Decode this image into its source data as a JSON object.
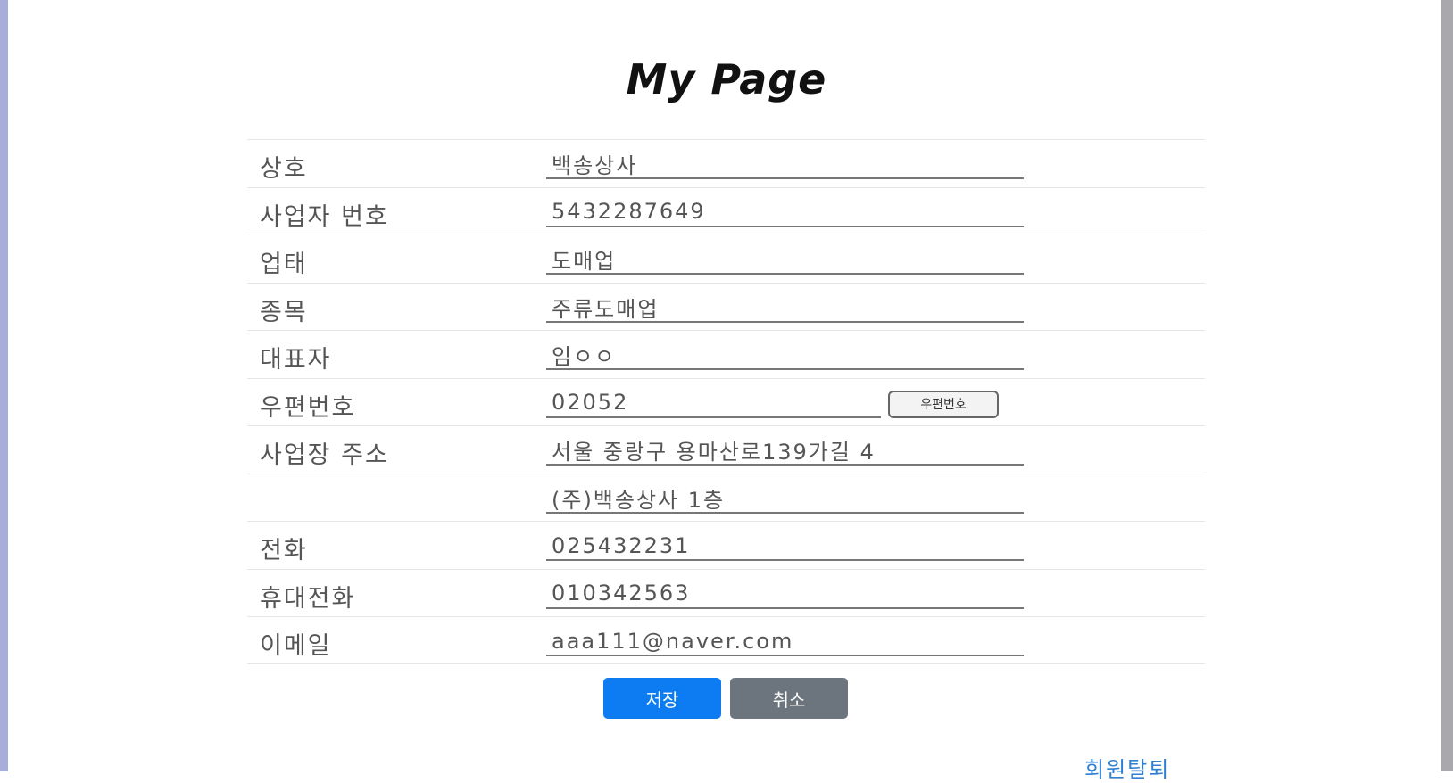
{
  "page": {
    "title": "My Page"
  },
  "form": {
    "rows": [
      {
        "label": "상호",
        "value": "백송상사"
      },
      {
        "label": "사업자 번호",
        "value": "5432287649"
      },
      {
        "label": "업태",
        "value": "도매업"
      },
      {
        "label": "종목",
        "value": "주류도매업"
      },
      {
        "label": "대표자",
        "value": "임ㅇㅇ"
      },
      {
        "label": "우편번호",
        "value": "02052",
        "button": "우편번호"
      },
      {
        "label": "사업장 주소",
        "value": "서울 중랑구 용마산로139가길 4"
      },
      {
        "label": "",
        "value": "(주)백송상사 1층"
      },
      {
        "label": "전화",
        "value": "025432231"
      },
      {
        "label": "휴대전화",
        "value": "010342563"
      },
      {
        "label": "이메일",
        "value": "aaa111@naver.com"
      }
    ]
  },
  "actions": {
    "save_label": "저장",
    "cancel_label": "취소",
    "withdraw_label": "회원탈퇴"
  },
  "colors": {
    "save_button": "#0d7cf2",
    "cancel_button": "#6c757d",
    "link": "#2f7fd3"
  }
}
